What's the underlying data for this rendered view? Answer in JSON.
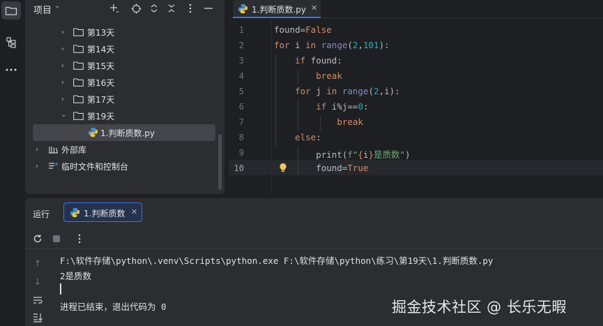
{
  "activity_bar": {
    "icons": [
      "folder-icon",
      "structure-icon",
      "more-icon"
    ]
  },
  "project": {
    "title": "项目",
    "tree": [
      {
        "label": "第13天",
        "type": "folder",
        "expanded": false
      },
      {
        "label": "第14天",
        "type": "folder",
        "expanded": false
      },
      {
        "label": "第15天",
        "type": "folder",
        "expanded": false
      },
      {
        "label": "第16天",
        "type": "folder",
        "expanded": false
      },
      {
        "label": "第17天",
        "type": "folder",
        "expanded": false
      },
      {
        "label": "第19天",
        "type": "folder",
        "expanded": true
      },
      {
        "label": "1.判断质数.py",
        "type": "python-file",
        "selected": true
      },
      {
        "label": "外部库",
        "type": "library"
      },
      {
        "label": "临时文件和控制台",
        "type": "scratches"
      }
    ]
  },
  "editor": {
    "tab_label": "1.判断质数.py",
    "current_line": 10,
    "line_numbers": [
      "1",
      "2",
      "3",
      "4",
      "5",
      "6",
      "7",
      "8",
      "9",
      "10"
    ]
  },
  "run_panel": {
    "title": "运行",
    "tab_label": "1.判断质数",
    "console": [
      "F:\\软件存储\\python\\.venv\\Scripts\\python.exe F:\\软件存储\\python\\练习\\第19天\\1.判断质数.py",
      "2是质数",
      "",
      "进程已结束，退出代码为 0"
    ]
  },
  "watermark": "掘金技术社区 @ 长乐无暇",
  "colors": {
    "accent": "#3574f0",
    "keyword": "#cf8e6d",
    "number": "#2aacb8",
    "string": "#6aab73",
    "panel": "#2b2d30",
    "editor_bg": "#1e1f22"
  }
}
